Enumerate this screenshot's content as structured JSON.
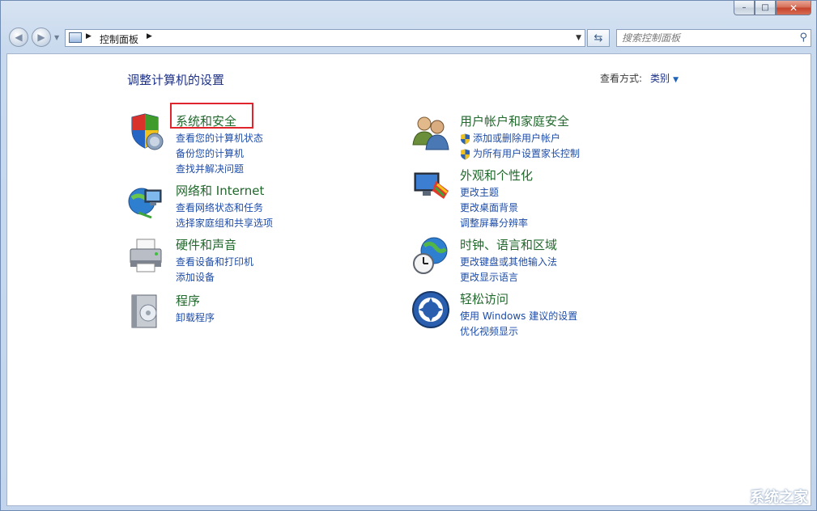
{
  "window": {
    "minimize": "–",
    "maximize": "□",
    "close": "✕"
  },
  "nav": {
    "breadcrumb": "控制面板",
    "search_placeholder": "搜索控制面板"
  },
  "main": {
    "title": "调整计算机的设置",
    "view_label": "查看方式:",
    "view_value": "类别"
  },
  "categories": [
    {
      "heading": "系统和安全",
      "icon": "shield-icon",
      "links": [
        "查看您的计算机状态",
        "备份您的计算机",
        "查找并解决问题"
      ]
    },
    {
      "heading": "网络和 Internet",
      "icon": "network-icon",
      "links": [
        "查看网络状态和任务",
        "选择家庭组和共享选项"
      ]
    },
    {
      "heading": "硬件和声音",
      "icon": "printer-icon",
      "links": [
        "查看设备和打印机",
        "添加设备"
      ]
    },
    {
      "heading": "程序",
      "icon": "programs-icon",
      "links": [
        "卸载程序"
      ]
    },
    {
      "heading": "用户帐户和家庭安全",
      "icon": "users-icon",
      "links": [
        "添加或删除用户帐户",
        "为所有用户设置家长控制"
      ]
    },
    {
      "heading": "外观和个性化",
      "icon": "appearance-icon",
      "links": [
        "更改主题",
        "更改桌面背景",
        "调整屏幕分辨率"
      ]
    },
    {
      "heading": "时钟、语言和区域",
      "icon": "clock-globe-icon",
      "links": [
        "更改键盘或其他输入法",
        "更改显示语言"
      ]
    },
    {
      "heading": "轻松访问",
      "icon": "ease-of-access-icon",
      "links": [
        "使用 Windows 建议的设置",
        "优化视频显示"
      ]
    }
  ],
  "watermark": "系统之家"
}
